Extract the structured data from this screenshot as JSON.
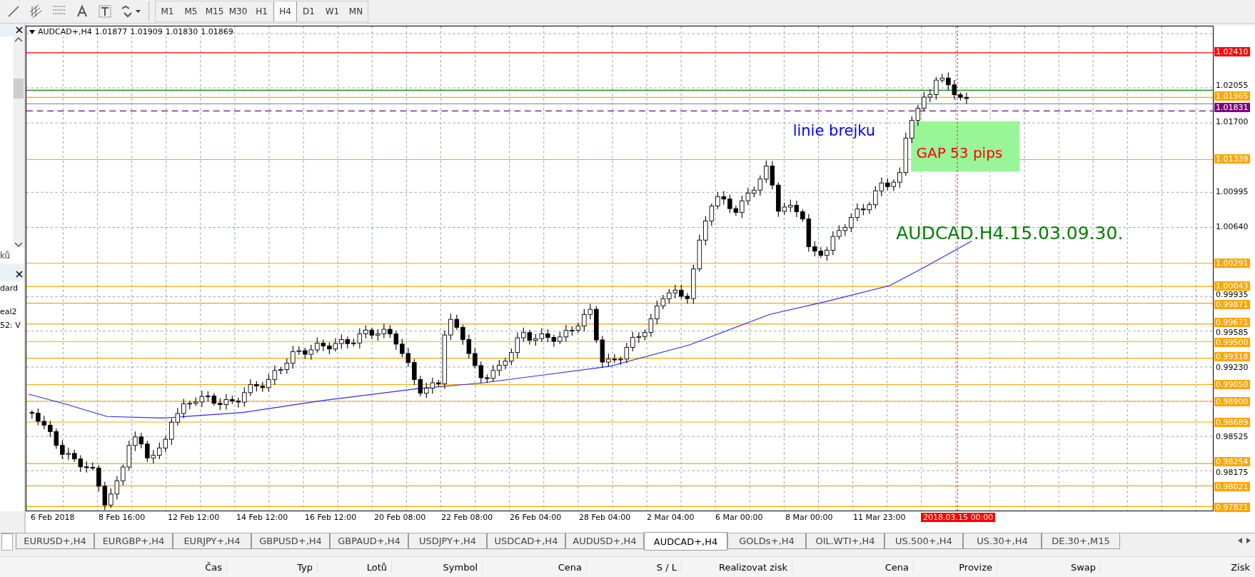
{
  "timeframes": [
    {
      "label": "M1",
      "selected": false
    },
    {
      "label": "M5",
      "selected": false
    },
    {
      "label": "M15",
      "selected": false
    },
    {
      "label": "M30",
      "selected": false
    },
    {
      "label": "H1",
      "selected": false
    },
    {
      "label": "H4",
      "selected": true
    },
    {
      "label": "D1",
      "selected": false
    },
    {
      "label": "W1",
      "selected": false
    },
    {
      "label": "MN",
      "selected": false
    }
  ],
  "left_panel": {
    "top_tab": "ků",
    "lines": [
      "dard",
      "eal2",
      "52: V"
    ]
  },
  "chart": {
    "symbol": "AUDCAD+,H4",
    "ohlc": [
      "1.01877",
      "1.01909",
      "1.01830",
      "1.01869"
    ],
    "breakout_label": "linie brejku",
    "gap_label": "GAP 53 pips",
    "stamp_label": "AUDCAD.H4.15.03.09.30."
  },
  "price_axis": [
    {
      "text": "1.02410",
      "kind": "tag",
      "color": "#ff0000"
    },
    {
      "text": "1.02055",
      "kind": "grid"
    },
    {
      "text": "1.01965",
      "kind": "tag",
      "color": "#ffa500"
    },
    {
      "text": "1.01831",
      "kind": "tag",
      "color": "#800080"
    },
    {
      "text": "1.01700",
      "kind": "grid"
    },
    {
      "text": "1.01339",
      "kind": "tag",
      "color": "#ffa500"
    },
    {
      "text": "1.00995",
      "kind": "grid"
    },
    {
      "text": "1.00640",
      "kind": "grid"
    },
    {
      "text": "1.00291",
      "kind": "tag",
      "color": "#ffa500"
    },
    {
      "text": "1.00043",
      "kind": "tag",
      "color": "#ffa500"
    },
    {
      "text": "0.99935",
      "kind": "grid"
    },
    {
      "text": "0.99871",
      "kind": "tag",
      "color": "#ffa500"
    },
    {
      "text": "0.99671",
      "kind": "tag",
      "color": "#ffa500"
    },
    {
      "text": "0.99585",
      "kind": "grid"
    },
    {
      "text": "0.99500",
      "kind": "tag",
      "color": "#ffa500"
    },
    {
      "text": "0.99318",
      "kind": "tag",
      "color": "#ffa500"
    },
    {
      "text": "0.99230",
      "kind": "grid"
    },
    {
      "text": "0.99050",
      "kind": "tag",
      "color": "#ffa500"
    },
    {
      "text": "0.98900",
      "kind": "tag",
      "color": "#ffa500"
    },
    {
      "text": "0.98689",
      "kind": "tag",
      "color": "#ffa500"
    },
    {
      "text": "0.98525",
      "kind": "grid"
    },
    {
      "text": "0.98254",
      "kind": "tag",
      "color": "#ffa500"
    },
    {
      "text": "0.98175",
      "kind": "grid"
    },
    {
      "text": "0.98021",
      "kind": "tag",
      "color": "#ffa500"
    },
    {
      "text": "0.97821",
      "kind": "tag",
      "color": "#ffa500"
    }
  ],
  "time_axis": [
    {
      "text": "6 Feb 2018",
      "highlighted": false
    },
    {
      "text": "8 Feb 16:00",
      "highlighted": false
    },
    {
      "text": "12 Feb 12:00",
      "highlighted": false
    },
    {
      "text": "14 Feb 12:00",
      "highlighted": false
    },
    {
      "text": "16 Feb 12:00",
      "highlighted": false
    },
    {
      "text": "20 Feb 08:00",
      "highlighted": false
    },
    {
      "text": "22 Feb 08:00",
      "highlighted": false
    },
    {
      "text": "26 Feb 04:00",
      "highlighted": false
    },
    {
      "text": "28 Feb 04:00",
      "highlighted": false
    },
    {
      "text": "2 Mar 04:00",
      "highlighted": false
    },
    {
      "text": "6 Mar 00:00",
      "highlighted": false
    },
    {
      "text": "8 Mar 00:00",
      "highlighted": false
    },
    {
      "text": "11 Mar 23:00",
      "highlighted": false
    },
    {
      "text": "2018.03.15 00:00",
      "highlighted": true
    }
  ],
  "symbol_tabs": [
    {
      "label": "EURUSD+,H4",
      "selected": false
    },
    {
      "label": "EURGBP+,H4",
      "selected": false
    },
    {
      "label": "EURJPY+,H4",
      "selected": false
    },
    {
      "label": "GBPUSD+,H4",
      "selected": false
    },
    {
      "label": "GBPAUD+,H4",
      "selected": false
    },
    {
      "label": "USDJPY+,H4",
      "selected": false
    },
    {
      "label": "USDCAD+,H4",
      "selected": false
    },
    {
      "label": "AUDUSD+,H4",
      "selected": false
    },
    {
      "label": "AUDCAD+,H4",
      "selected": true
    },
    {
      "label": "GOLDs+,H4",
      "selected": false
    },
    {
      "label": "OIL.WTI+,H4",
      "selected": false
    },
    {
      "label": "US.500+,H4",
      "selected": false
    },
    {
      "label": "US.30+,H4",
      "selected": false
    },
    {
      "label": "DE.30+,M15",
      "selected": false
    }
  ],
  "trade_columns": [
    "Čas",
    "Typ",
    "Lotů",
    "Symbol",
    "Cena",
    "S / L",
    "Realizovat zisk",
    "Cena",
    "Provize",
    "Swap",
    "Zisk"
  ]
}
